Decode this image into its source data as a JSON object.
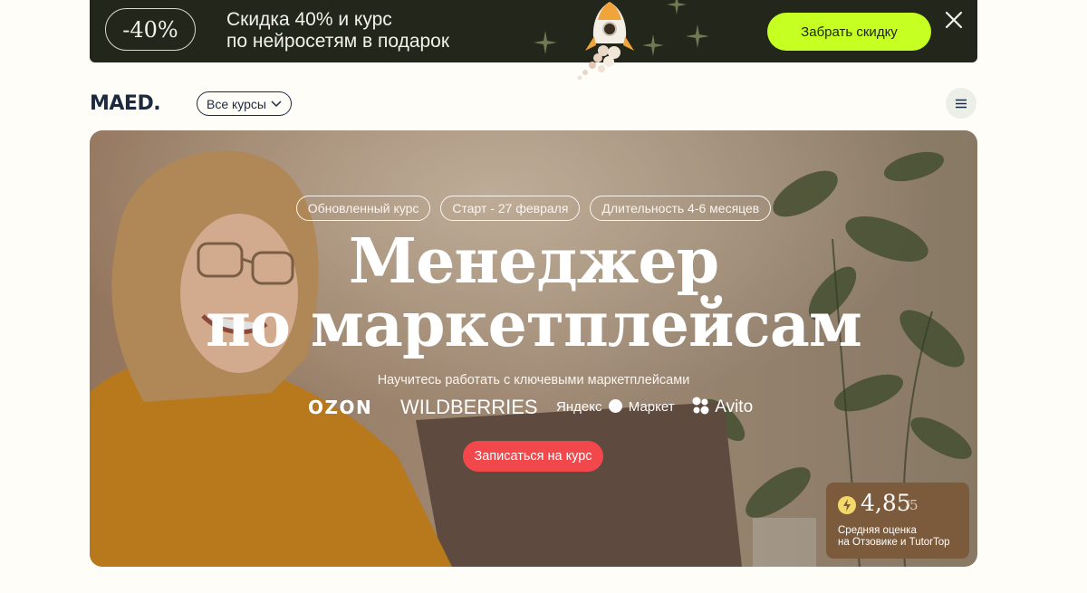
{
  "promo": {
    "discount": "-40%",
    "line1": "Скидка 40% и курс",
    "line2": "по нейросетям в подарок",
    "button": "Забрать скидку",
    "button_color": "#c6ff22",
    "background": "#23261a",
    "close_icon": "close-icon"
  },
  "header": {
    "logo": "MAED.",
    "courses_button": "Все курсы",
    "menu_icon": "hamburger-icon"
  },
  "hero": {
    "tags": [
      "Обновленный курс",
      "Старт - 27 февраля",
      "Длительность 4-6 месяцев"
    ],
    "title_line1": "Менеджер",
    "title_line2": "по маркетплейсам",
    "subtitle": "Научитесь работать с ключевыми маркетплейсами",
    "marketplaces": [
      "OZON",
      "WILDBERRIES",
      "Яндекс",
      "Маркет",
      "Avito"
    ],
    "cta": "Записаться на курс",
    "cta_color": "#f2484c",
    "rating": {
      "value": "4,85",
      "max": "/5",
      "label_line1": "Средняя оценка",
      "label_line2": "на Отзовике и TutorTop",
      "icon": "lightning-icon"
    }
  }
}
